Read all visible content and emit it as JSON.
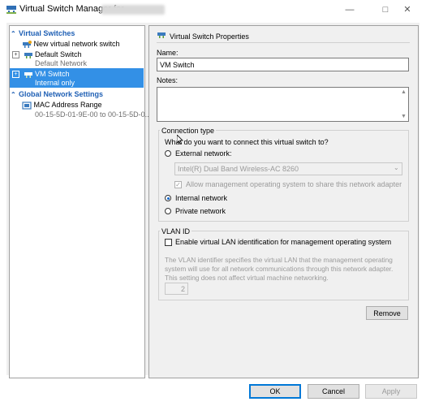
{
  "window": {
    "title": "Virtual Switch Manager for",
    "minimize": "—",
    "maximize": "□",
    "close": "✕"
  },
  "tree": {
    "virtual_switches_header": "Virtual Switches",
    "new_switch": "New virtual network switch",
    "default_switch": {
      "name": "Default Switch",
      "sub": "Default Network"
    },
    "vm_switch": {
      "name": "VM Switch",
      "sub": "Internal only"
    },
    "global_header": "Global Network Settings",
    "mac_range": {
      "name": "MAC Address Range",
      "sub": "00-15-5D-01-9E-00 to 00-15-5D-0..."
    }
  },
  "props": {
    "title": "Virtual Switch Properties",
    "name_label": "Name:",
    "name_value": "VM Switch",
    "notes_label": "Notes:",
    "notes_value": "",
    "connection_type": {
      "group_label": "Connection type",
      "question": "What do you want to connect this virtual switch to?",
      "external_label": "External network:",
      "adapter_value": "Intel(R) Dual Band Wireless-AC 8260",
      "allow_mgmt_label": "Allow management operating system to share this network adapter",
      "internal_label": "Internal network",
      "private_label": "Private network",
      "selected": "Internal network"
    },
    "vlan": {
      "group_label": "VLAN ID",
      "enable_label": "Enable virtual LAN identification for management operating system",
      "description": "The VLAN identifier specifies the virtual LAN that the management operating system will use for all network communications through this network adapter. This setting does not affect virtual machine networking.",
      "id_value": "2"
    },
    "remove_label": "Remove"
  },
  "footer": {
    "ok_label": "OK",
    "cancel_label": "Cancel",
    "apply_label": "Apply"
  },
  "colors": {
    "selection": "#3390e6",
    "section_header": "#1e5fb4"
  }
}
